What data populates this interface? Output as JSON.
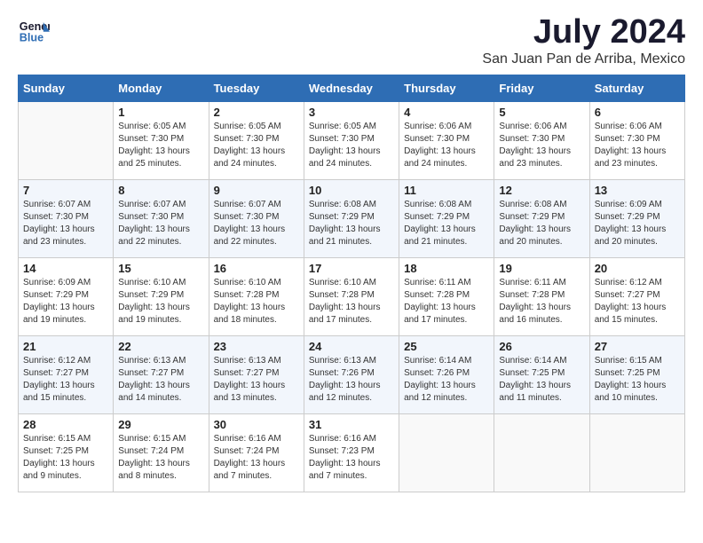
{
  "header": {
    "logo_line1": "General",
    "logo_line2": "Blue",
    "month": "July 2024",
    "location": "San Juan Pan de Arriba, Mexico"
  },
  "days_of_week": [
    "Sunday",
    "Monday",
    "Tuesday",
    "Wednesday",
    "Thursday",
    "Friday",
    "Saturday"
  ],
  "weeks": [
    [
      {
        "day": "",
        "content": ""
      },
      {
        "day": "1",
        "content": "Sunrise: 6:05 AM\nSunset: 7:30 PM\nDaylight: 13 hours\nand 25 minutes."
      },
      {
        "day": "2",
        "content": "Sunrise: 6:05 AM\nSunset: 7:30 PM\nDaylight: 13 hours\nand 24 minutes."
      },
      {
        "day": "3",
        "content": "Sunrise: 6:05 AM\nSunset: 7:30 PM\nDaylight: 13 hours\nand 24 minutes."
      },
      {
        "day": "4",
        "content": "Sunrise: 6:06 AM\nSunset: 7:30 PM\nDaylight: 13 hours\nand 24 minutes."
      },
      {
        "day": "5",
        "content": "Sunrise: 6:06 AM\nSunset: 7:30 PM\nDaylight: 13 hours\nand 23 minutes."
      },
      {
        "day": "6",
        "content": "Sunrise: 6:06 AM\nSunset: 7:30 PM\nDaylight: 13 hours\nand 23 minutes."
      }
    ],
    [
      {
        "day": "7",
        "content": "Sunrise: 6:07 AM\nSunset: 7:30 PM\nDaylight: 13 hours\nand 23 minutes."
      },
      {
        "day": "8",
        "content": "Sunrise: 6:07 AM\nSunset: 7:30 PM\nDaylight: 13 hours\nand 22 minutes."
      },
      {
        "day": "9",
        "content": "Sunrise: 6:07 AM\nSunset: 7:30 PM\nDaylight: 13 hours\nand 22 minutes."
      },
      {
        "day": "10",
        "content": "Sunrise: 6:08 AM\nSunset: 7:29 PM\nDaylight: 13 hours\nand 21 minutes."
      },
      {
        "day": "11",
        "content": "Sunrise: 6:08 AM\nSunset: 7:29 PM\nDaylight: 13 hours\nand 21 minutes."
      },
      {
        "day": "12",
        "content": "Sunrise: 6:08 AM\nSunset: 7:29 PM\nDaylight: 13 hours\nand 20 minutes."
      },
      {
        "day": "13",
        "content": "Sunrise: 6:09 AM\nSunset: 7:29 PM\nDaylight: 13 hours\nand 20 minutes."
      }
    ],
    [
      {
        "day": "14",
        "content": "Sunrise: 6:09 AM\nSunset: 7:29 PM\nDaylight: 13 hours\nand 19 minutes."
      },
      {
        "day": "15",
        "content": "Sunrise: 6:10 AM\nSunset: 7:29 PM\nDaylight: 13 hours\nand 19 minutes."
      },
      {
        "day": "16",
        "content": "Sunrise: 6:10 AM\nSunset: 7:28 PM\nDaylight: 13 hours\nand 18 minutes."
      },
      {
        "day": "17",
        "content": "Sunrise: 6:10 AM\nSunset: 7:28 PM\nDaylight: 13 hours\nand 17 minutes."
      },
      {
        "day": "18",
        "content": "Sunrise: 6:11 AM\nSunset: 7:28 PM\nDaylight: 13 hours\nand 17 minutes."
      },
      {
        "day": "19",
        "content": "Sunrise: 6:11 AM\nSunset: 7:28 PM\nDaylight: 13 hours\nand 16 minutes."
      },
      {
        "day": "20",
        "content": "Sunrise: 6:12 AM\nSunset: 7:27 PM\nDaylight: 13 hours\nand 15 minutes."
      }
    ],
    [
      {
        "day": "21",
        "content": "Sunrise: 6:12 AM\nSunset: 7:27 PM\nDaylight: 13 hours\nand 15 minutes."
      },
      {
        "day": "22",
        "content": "Sunrise: 6:13 AM\nSunset: 7:27 PM\nDaylight: 13 hours\nand 14 minutes."
      },
      {
        "day": "23",
        "content": "Sunrise: 6:13 AM\nSunset: 7:27 PM\nDaylight: 13 hours\nand 13 minutes."
      },
      {
        "day": "24",
        "content": "Sunrise: 6:13 AM\nSunset: 7:26 PM\nDaylight: 13 hours\nand 12 minutes."
      },
      {
        "day": "25",
        "content": "Sunrise: 6:14 AM\nSunset: 7:26 PM\nDaylight: 13 hours\nand 12 minutes."
      },
      {
        "day": "26",
        "content": "Sunrise: 6:14 AM\nSunset: 7:25 PM\nDaylight: 13 hours\nand 11 minutes."
      },
      {
        "day": "27",
        "content": "Sunrise: 6:15 AM\nSunset: 7:25 PM\nDaylight: 13 hours\nand 10 minutes."
      }
    ],
    [
      {
        "day": "28",
        "content": "Sunrise: 6:15 AM\nSunset: 7:25 PM\nDaylight: 13 hours\nand 9 minutes."
      },
      {
        "day": "29",
        "content": "Sunrise: 6:15 AM\nSunset: 7:24 PM\nDaylight: 13 hours\nand 8 minutes."
      },
      {
        "day": "30",
        "content": "Sunrise: 6:16 AM\nSunset: 7:24 PM\nDaylight: 13 hours\nand 7 minutes."
      },
      {
        "day": "31",
        "content": "Sunrise: 6:16 AM\nSunset: 7:23 PM\nDaylight: 13 hours\nand 7 minutes."
      },
      {
        "day": "",
        "content": ""
      },
      {
        "day": "",
        "content": ""
      },
      {
        "day": "",
        "content": ""
      }
    ]
  ]
}
